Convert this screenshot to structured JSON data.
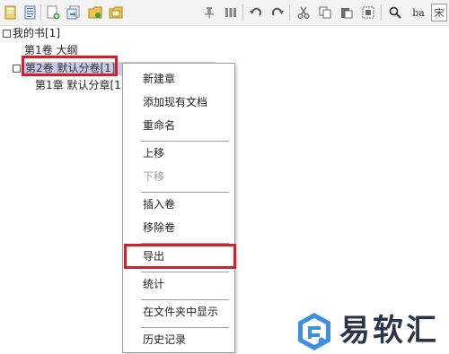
{
  "toolbar": {
    "format_label": "宋",
    "replace_label": "ba"
  },
  "tree": {
    "root_label": "我的书[1]",
    "outline_label": "第1卷 大纲",
    "volume_label": "第2卷 默认分卷[1]",
    "chapter_label": "第1章 默认分章[1]"
  },
  "context_menu": {
    "items": [
      {
        "label": "新建章",
        "enabled": true
      },
      {
        "label": "添加现有文档",
        "enabled": true
      },
      {
        "label": "重命名",
        "enabled": true
      },
      {
        "label": "上移",
        "enabled": true
      },
      {
        "label": "下移",
        "enabled": false
      },
      {
        "label": "插入卷",
        "enabled": true
      },
      {
        "label": "移除卷",
        "enabled": true
      },
      {
        "label": "导出",
        "enabled": true,
        "highlighted": true
      },
      {
        "label": "统计",
        "enabled": true
      },
      {
        "label": "在文件夹中显示",
        "enabled": true
      },
      {
        "label": "历史记录",
        "enabled": true
      }
    ]
  },
  "watermark": {
    "brand_text": "易软汇"
  },
  "colors": {
    "highlight_red": "#d0202a",
    "selection": "#c7cbe7",
    "brand_blue": "#3d8fe0"
  }
}
